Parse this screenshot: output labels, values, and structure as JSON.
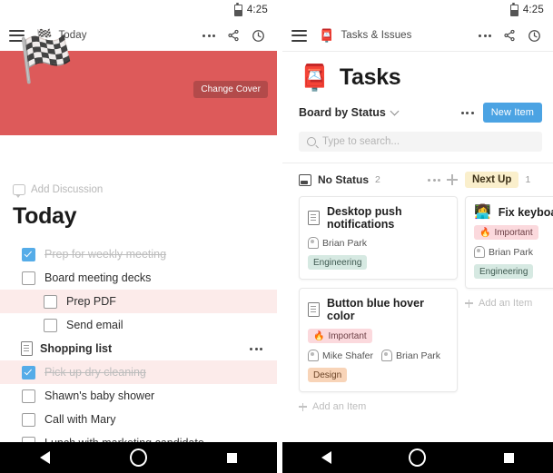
{
  "left_phone": {
    "status_bar": {
      "time": "4:25",
      "battery_icon": "battery-icon"
    },
    "app_bar": {
      "menu_icon": "hamburger-menu-icon",
      "doc_emoji": "🏁",
      "title": "Today",
      "more_icon": "more-options-icon",
      "share_icon": "share-icon",
      "history_icon": "clock-history-icon"
    },
    "cover": {
      "color": "#dd5a5a",
      "change_cover_label": "Change Cover",
      "emoji": "🏁"
    },
    "add_discussion_label": "Add Discussion",
    "page_title": "Today",
    "tasks": [
      {
        "type": "task",
        "label": "Prep for weekly meeting",
        "checked": true,
        "indent": 0,
        "highlight": false
      },
      {
        "type": "task",
        "label": "Board meeting decks",
        "checked": false,
        "indent": 0,
        "highlight": false
      },
      {
        "type": "task",
        "label": "Prep PDF",
        "checked": false,
        "indent": 1,
        "highlight": true
      },
      {
        "type": "task",
        "label": "Send email",
        "checked": false,
        "indent": 1,
        "highlight": false
      },
      {
        "type": "doc",
        "label": "Shopping list",
        "menu": "more-options-icon"
      },
      {
        "type": "task",
        "label": "Pick up dry cleaning",
        "checked": true,
        "indent": 0,
        "highlight": true
      },
      {
        "type": "task",
        "label": "Shawn's baby shower",
        "checked": false,
        "indent": 0,
        "highlight": false
      },
      {
        "type": "task",
        "label": "Call with Mary",
        "checked": false,
        "indent": 0,
        "highlight": false
      },
      {
        "type": "task",
        "label": "Lunch with marketing candidate",
        "checked": false,
        "indent": 0,
        "highlight": false
      }
    ],
    "nav": {
      "back": "back-nav-icon",
      "home": "home-nav-icon",
      "recents": "recents-nav-icon"
    }
  },
  "right_phone": {
    "status_bar": {
      "time": "4:25",
      "battery_icon": "battery-icon"
    },
    "app_bar": {
      "menu_icon": "hamburger-menu-icon",
      "doc_emoji": "📮",
      "title": "Tasks & Issues",
      "more_icon": "more-options-icon",
      "share_icon": "share-icon",
      "history_icon": "clock-history-icon"
    },
    "page_emoji": "📮",
    "page_title": "Tasks",
    "board": {
      "view_label": "Board by Status",
      "more_icon": "more-options-icon",
      "new_item_label": "New Item",
      "new_item_color": "#4ba3e3"
    },
    "search": {
      "placeholder": "Type to search...",
      "icon": "search-icon"
    },
    "columns": [
      {
        "name": "No Status",
        "count": "2",
        "icon": "inbox-icon",
        "chip": false,
        "more_icon": "more-options-icon",
        "add_icon": "plus-icon",
        "cards": [
          {
            "emoji": "",
            "doc_icon": "document-icon",
            "title": "Desktop push notifications",
            "tags_top": [],
            "people": [
              "Brian Park"
            ],
            "tags_bottom": [
              {
                "label": "Engineering",
                "style": "eng"
              }
            ]
          },
          {
            "emoji": "",
            "doc_icon": "document-icon",
            "title": "Button blue hover color",
            "tags_top": [
              {
                "label": "Important",
                "style": "important",
                "emoji": "🔥"
              }
            ],
            "people": [
              "Mike Shafer",
              "Brian Park"
            ],
            "tags_bottom": [
              {
                "label": "Design",
                "style": "design"
              }
            ]
          }
        ],
        "add_item_label": "Add an Item"
      },
      {
        "name": "Next Up",
        "count": "1",
        "icon": "",
        "chip": true,
        "chip_color": "#faefcc",
        "more_icon": "",
        "add_icon": "",
        "cards": [
          {
            "emoji": "👩‍💻",
            "doc_icon": "",
            "title": "Fix keyboa",
            "tags_top": [
              {
                "label": "Important",
                "style": "important",
                "emoji": "🔥"
              }
            ],
            "people": [
              "Brian Park"
            ],
            "tags_bottom": [
              {
                "label": "Engineering",
                "style": "eng"
              }
            ]
          }
        ],
        "add_item_label": "Add an Item"
      }
    ],
    "nav": {
      "back": "back-nav-icon",
      "home": "home-nav-icon",
      "recents": "recents-nav-icon"
    }
  }
}
